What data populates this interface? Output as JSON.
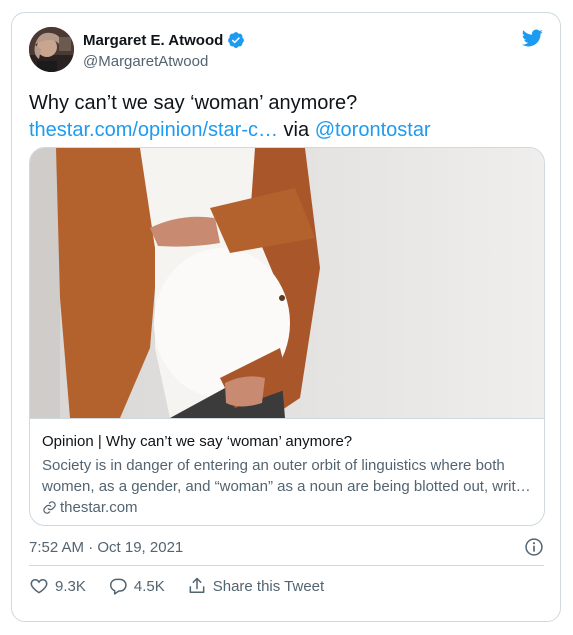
{
  "author": {
    "display_name": "Margaret E. Atwood",
    "handle": "@MargaretAtwood",
    "verified_icon": "verified-badge-icon"
  },
  "tweet": {
    "text_prefix": "Why can’t we say ‘woman’ anymore?",
    "link_text": "thestar.com/opinion/star-c…",
    "via": " via ",
    "mention": "@torontostar"
  },
  "card": {
    "title": "Opinion | Why can’t we say ‘woman’ anymore?",
    "description": "Society is in danger of entering an outer orbit of linguistics where both women, as a gender, and “woman” as a noun are being blotted out, writ…",
    "domain": "thestar.com"
  },
  "meta": {
    "timestamp": "7:52 AM · Oct 19, 2021"
  },
  "actions": {
    "likes": "9.3K",
    "replies": "4.5K",
    "share_label": "Share this Tweet"
  },
  "colors": {
    "accent": "#1d9bf0",
    "secondary_text": "#536471",
    "border": "#cfd9de"
  }
}
